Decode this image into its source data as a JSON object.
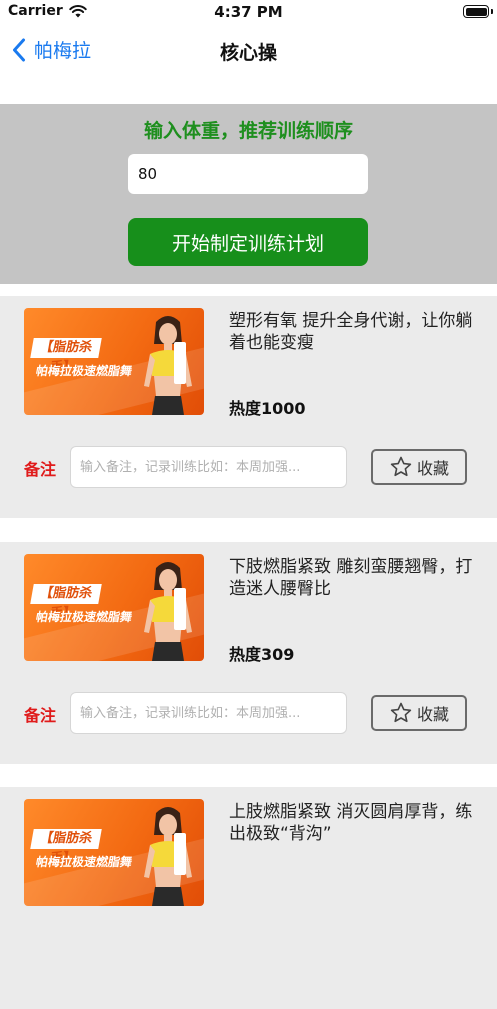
{
  "status_bar": {
    "carrier": "Carrier",
    "time": "4:37 PM",
    "battery_level": 1.0,
    "wifi_icon": "wifi-icon",
    "battery_icon": "battery-icon"
  },
  "nav": {
    "back_label": "帕梅拉",
    "back_icon": "chevron-left-icon",
    "title": "核心操"
  },
  "plan": {
    "prompt": "输入体重，推荐训练顺序",
    "weight_value": "80",
    "button_label": "开始制定训练计划"
  },
  "cards": [
    {
      "thumb_badge": "【脂肪杀手】",
      "thumb_sub": "帕梅拉极速燃脂舞",
      "title": "塑形有氧 提升全身代谢，让你躺着也能变瘦",
      "heat": "热度1000",
      "note_label": "备注",
      "note_placeholder": "输入备注，记录训练比如：本周加强...",
      "fav_label": "收藏"
    },
    {
      "thumb_badge": "【脂肪杀手】",
      "thumb_sub": "帕梅拉极速燃脂舞",
      "title": "下肢燃脂紧致 雕刻蛮腰翘臀，打造迷人腰臀比",
      "heat": "热度309",
      "note_label": "备注",
      "note_placeholder": "输入备注，记录训练比如：本周加强...",
      "fav_label": "收藏"
    },
    {
      "thumb_badge": "【脂肪杀手】",
      "thumb_sub": "帕梅拉极速燃脂舞",
      "title": "上肢燃脂紧致 消灭圆肩厚背，练出极致“背沟”"
    }
  ],
  "colors": {
    "accent_green": "#178f1b",
    "title_green": "#1e8f1e",
    "link_blue": "#1a7aef",
    "note_red": "#e01b1b",
    "card_bg": "#ebebeb",
    "panel_bg": "#c4c4c4"
  }
}
